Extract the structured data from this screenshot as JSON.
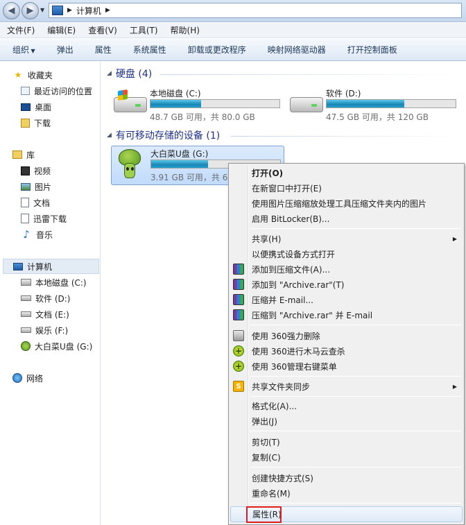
{
  "address": {
    "location": "计算机",
    "separator": "▶"
  },
  "menubar": [
    "文件(F)",
    "编辑(E)",
    "查看(V)",
    "工具(T)",
    "帮助(H)"
  ],
  "commands": [
    "组织",
    "弹出",
    "属性",
    "系统属性",
    "卸载或更改程序",
    "映射网络驱动器",
    "打开控制面板"
  ],
  "nav": {
    "favorites": {
      "label": "收藏夹",
      "items": [
        "最近访问的位置",
        "桌面",
        "下载"
      ]
    },
    "libraries": {
      "label": "库",
      "items": [
        "视频",
        "图片",
        "文档",
        "迅雷下载",
        "音乐"
      ]
    },
    "computer": {
      "label": "计算机",
      "items": [
        "本地磁盘 (C:)",
        "软件 (D:)",
        "文档 (E:)",
        "娱乐 (F:)",
        "大白菜U盘 (G:)"
      ]
    },
    "network": {
      "label": "网络"
    }
  },
  "groups": {
    "hdd": {
      "label": "硬盘 (4)"
    },
    "removable": {
      "label": "有可移动存储的设备 (1)"
    }
  },
  "drives": [
    {
      "name": "本地磁盘 (C:)",
      "info": "48.7 GB 可用，共 80.0 GB",
      "used_fraction": 0.39
    },
    {
      "name": "软件 (D:)",
      "info": "47.5 GB 可用，共 120 GB",
      "used_fraction": 0.6
    },
    {
      "name": "大白菜U盘 (G:)",
      "info": "3.91 GB 可用，共 6.",
      "used_fraction": 0.44
    }
  ],
  "context_menu": {
    "open": "打开(O)",
    "open_new_window": "在新窗口中打开(E)",
    "compress_images": "使用图片压缩缩放处理工具压缩文件夹内的图片",
    "bitlocker": "启用 BitLocker(B)...",
    "share": "共享(H)",
    "portable_open": "以便携式设备方式打开",
    "add_archive": "添加到压缩文件(A)...",
    "add_rar": "添加到 \"Archive.rar\"(T)",
    "compress_email": "压缩并 E-mail...",
    "compress_rar_email": "压缩到 \"Archive.rar\" 并 E-mail",
    "del360": "使用 360强力删除",
    "scan360": "使用 360进行木马云查杀",
    "manage360": "使用 360管理右键菜单",
    "sync": "共享文件夹同步",
    "format": "格式化(A)...",
    "eject": "弹出(J)",
    "cut": "剪切(T)",
    "copy": "复制(C)",
    "shortcut": "创建快捷方式(S)",
    "rename": "重命名(M)",
    "properties": "属性(R)"
  },
  "colors": {
    "highlight_box": "#e01c1c",
    "group_header": "#1e3287",
    "drive_bar": "#1a86b6"
  }
}
